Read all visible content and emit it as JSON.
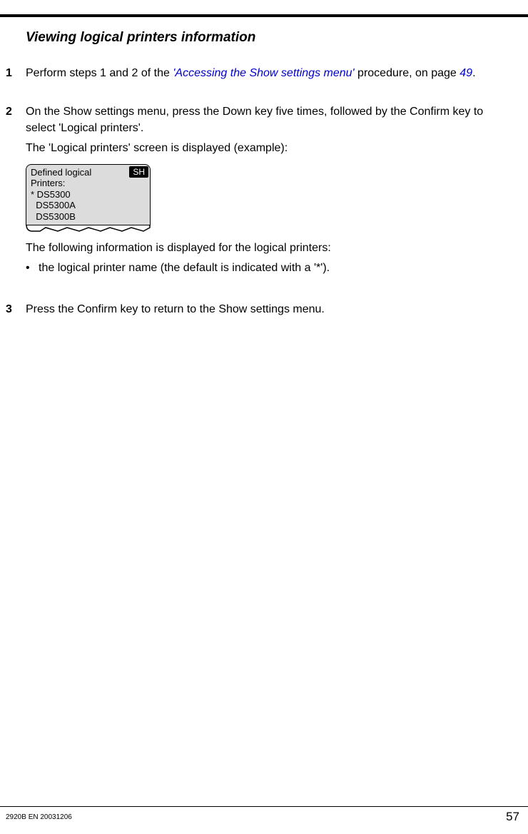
{
  "heading": "Viewing logical printers information",
  "step1": {
    "num": "1",
    "pre": "Perform steps 1 and 2 of the ",
    "link": "'Accessing the Show settings menu'",
    "post": " procedure, on page ",
    "pagelink": "49",
    "end": "."
  },
  "step2": {
    "num": "2",
    "p1": "On the Show settings menu, press the Down key five times, followed by the Confirm key to select 'Logical printers'.",
    "p2": "The 'Logical printers' screen is displayed (example):",
    "display": {
      "line1": "Defined logical",
      "line2": "Printers:",
      "line3": "* DS5300",
      "line4": "  DS5300A",
      "line5": "  DS5300B",
      "badge": "SH"
    },
    "after": "The following information is displayed for the logical printers:",
    "bullet1": "the logical printer name (the default is indicated with a '*')."
  },
  "step3": {
    "num": "3",
    "p1": "Press the Confirm key to return to the Show settings menu."
  },
  "footer": {
    "left": "2920B EN 20031206",
    "right": "57"
  }
}
